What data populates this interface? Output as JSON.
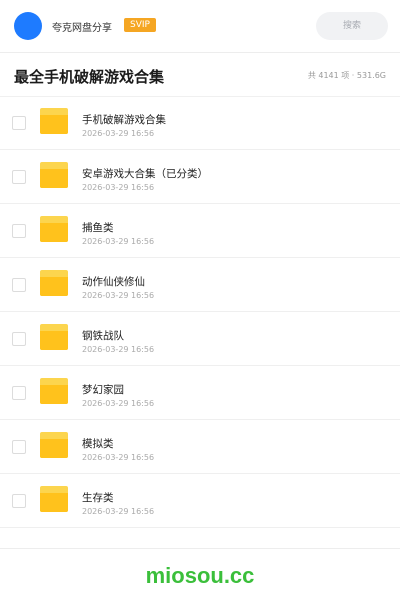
{
  "header": {
    "brand": "夸克网盘分享",
    "badge": "SVIP",
    "search_placeholder": "搜索"
  },
  "folder": {
    "title": "最全手机破解游戏合集",
    "summary": "共 4141 项 · 531.6G"
  },
  "items": [
    {
      "name": "手机破解游戏合集",
      "date": "2026-03-29 16:56"
    },
    {
      "name": "安卓游戏大合集（已分类）",
      "date": "2026-03-29 16:56"
    },
    {
      "name": "捕鱼类",
      "date": "2026-03-29 16:56"
    },
    {
      "name": "动作仙侠修仙",
      "date": "2026-03-29 16:56"
    },
    {
      "name": "钢铁战队",
      "date": "2026-03-29 16:56"
    },
    {
      "name": "梦幻家园",
      "date": "2026-03-29 16:56"
    },
    {
      "name": "模拟类",
      "date": "2026-03-29 16:56"
    },
    {
      "name": "生存类",
      "date": "2026-03-29 16:56"
    }
  ],
  "watermark": "miosou.cc",
  "colors": {
    "accent": "#1e7bff",
    "svip": "#f5a623",
    "folder": "#ffc21c",
    "watermark": "#3bbf3b"
  }
}
